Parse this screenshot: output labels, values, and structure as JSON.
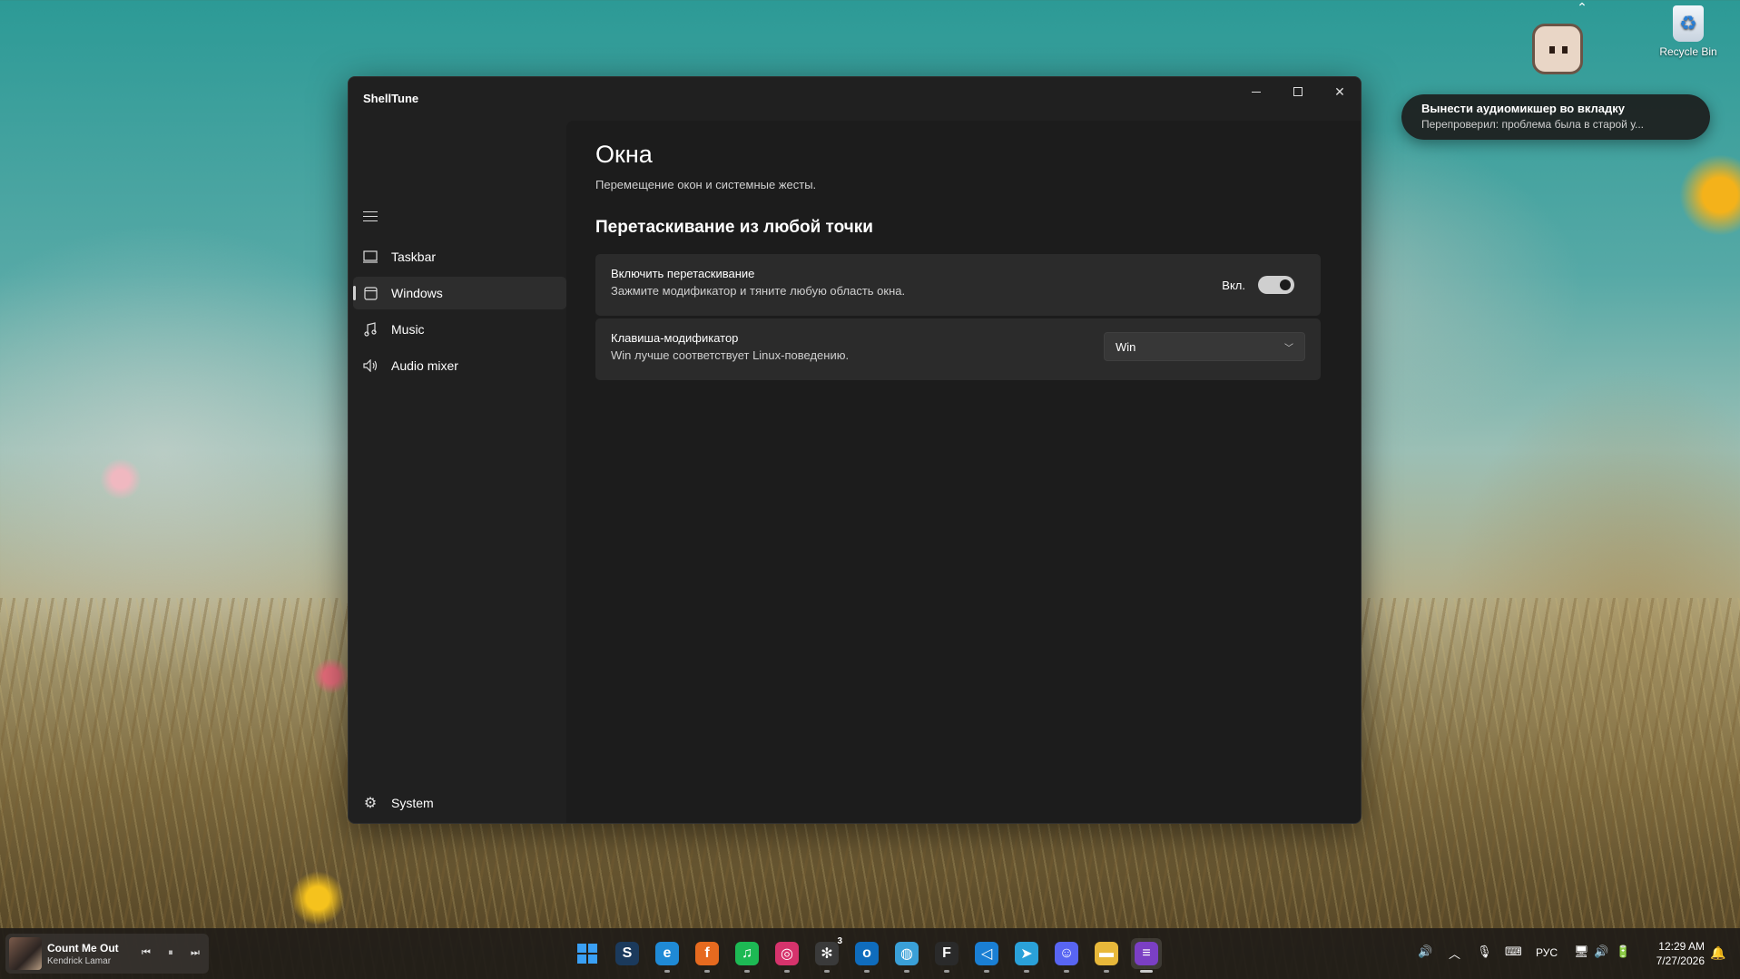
{
  "desktop": {
    "recycle_bin_label": "Recycle Bin",
    "toast": {
      "title": "Вынести аудиомикшер во вкладку",
      "text": "Перепроверил: проблема была в старой у..."
    }
  },
  "window": {
    "title": "ShellTune",
    "controls": {
      "minimize_icon": "minimize-icon",
      "maximize_icon": "maximize-icon",
      "close_icon": "close-icon"
    }
  },
  "sidebar": {
    "items": [
      {
        "label": "Taskbar",
        "icon": "taskbar-icon",
        "active": false
      },
      {
        "label": "Windows",
        "icon": "window-icon",
        "active": true
      },
      {
        "label": "Music",
        "icon": "music-icon",
        "active": false
      },
      {
        "label": "Audio mixer",
        "icon": "speaker-icon",
        "active": false
      }
    ],
    "system": {
      "label": "System",
      "icon": "gear-icon"
    }
  },
  "page": {
    "title": "Окна",
    "subtitle": "Перемещение окон и системные жесты.",
    "section_title": "Перетаскивание из любой точки",
    "settings": [
      {
        "title": "Включить перетаскивание",
        "description": "Зажмите модификатор и тяните любую область окна.",
        "toggle_label": "Вкл.",
        "toggle_on": true
      },
      {
        "title": "Клавиша-модификатор",
        "description": "Win лучше соответствует Linux-поведению.",
        "selected_value": "Win"
      }
    ]
  },
  "taskbar": {
    "media": {
      "song": "Count Me Out",
      "artist": "Kendrick Lamar"
    },
    "apps": [
      {
        "name": "start",
        "glyph": "",
        "color": "#2a8cf0"
      },
      {
        "name": "steam",
        "glyph": "S",
        "color": "#1b3a5c"
      },
      {
        "name": "edge",
        "glyph": "e",
        "color": "#1f8ad6"
      },
      {
        "name": "firefox",
        "glyph": "f",
        "color": "#e66a1f"
      },
      {
        "name": "spotify",
        "glyph": "♫",
        "color": "#1db954"
      },
      {
        "name": "instagram",
        "glyph": "◎",
        "color": "#d6336c"
      },
      {
        "name": "chatgpt",
        "glyph": "✻",
        "color": "#3a3a3a",
        "badge": "3"
      },
      {
        "name": "outlook",
        "glyph": "o",
        "color": "#0f6cbd"
      },
      {
        "name": "browser",
        "glyph": "◍",
        "color": "#3aa0d8"
      },
      {
        "name": "figma",
        "glyph": "F",
        "color": "#2a2a2a"
      },
      {
        "name": "vscode",
        "glyph": "◁",
        "color": "#1a7fd4"
      },
      {
        "name": "telegram",
        "glyph": "➤",
        "color": "#2aa1d9"
      },
      {
        "name": "discord",
        "glyph": "☺",
        "color": "#5865f2"
      },
      {
        "name": "file-explorer",
        "glyph": "▬",
        "color": "#e8b83a"
      },
      {
        "name": "shelltune",
        "glyph": "≡",
        "color": "#7b3fc4"
      }
    ],
    "tray": {
      "language": "РУС",
      "time": "12:29 AM",
      "date": "7/27/2026"
    }
  }
}
